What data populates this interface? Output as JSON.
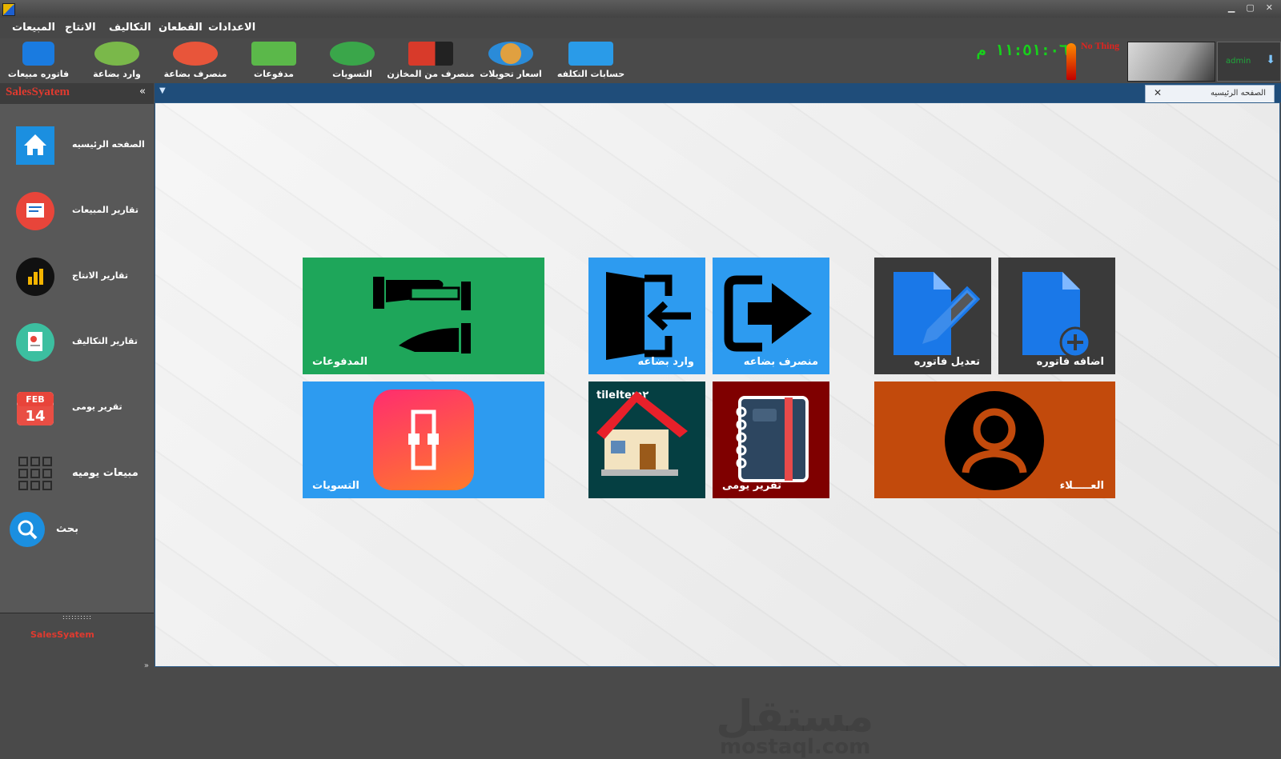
{
  "menu": [
    "المبيعات",
    "الانتاج",
    "التكاليف",
    "القطعان",
    "الاعدادات"
  ],
  "toolbar": [
    {
      "label": "فاتوره مبيعات",
      "icon": "invoice-icon",
      "color": "#1a7be0"
    },
    {
      "label": "وارد بضاعة",
      "icon": "incoming-goods-icon",
      "color": "#7ab84a"
    },
    {
      "label": "منصرف بضاعة",
      "icon": "outgoing-goods-icon",
      "color": "#e8553a"
    },
    {
      "label": "مدفوعات",
      "icon": "payments-icon",
      "color": "#5bb84a"
    },
    {
      "label": "التسويات",
      "icon": "settlements-icon",
      "color": "#3aa64a"
    },
    {
      "label": "منصرف من المخازن",
      "icon": "warehouse-exit-icon",
      "color": "#d83a2a"
    },
    {
      "label": "اسعار تحويلات",
      "icon": "conversion-rates-icon",
      "color": "#2a8bd8"
    },
    {
      "label": "حسابات التكلفه",
      "icon": "cost-accounts-icon",
      "color": "#2a9be8"
    }
  ],
  "status": {
    "clock": "١١:٥١:٠٦ م",
    "note": "No Thing",
    "user": "admin"
  },
  "sidebar": {
    "title": "SalesSyatem",
    "footer": "SalesSyatem",
    "items": [
      {
        "label": "الصفحه الرئيسيه",
        "icon": "home-icon"
      },
      {
        "label": "تقارير المبيعات",
        "icon": "sales-report-icon"
      },
      {
        "label": "تقارير الانتاج",
        "icon": "production-report-icon"
      },
      {
        "label": "تقارير التكاليف",
        "icon": "cost-report-icon"
      },
      {
        "label": "تقرير يومى",
        "icon": "calendar-icon",
        "month": "FEB",
        "day": "14"
      },
      {
        "label": "مبيعات يوميه",
        "icon": "grid-icon"
      },
      {
        "label": "بحث",
        "icon": "search-icon"
      }
    ]
  },
  "tab": {
    "label": "الصفحه الرئيسيه"
  },
  "tiles": {
    "payments": "المدفوعات",
    "settlements": "التسويات",
    "incoming": "وارد بضاعه",
    "outgoing": "منصرف بضاعه",
    "tile_item": "tileItem٢",
    "daily_report": "تقرير يومى",
    "edit_invoice": "تعديل فاتوره",
    "add_invoice": "اضافه فاتوره",
    "customers": "العـــــلاء"
  },
  "watermark": {
    "ar": "مستقل",
    "en": "mostaql.com"
  }
}
